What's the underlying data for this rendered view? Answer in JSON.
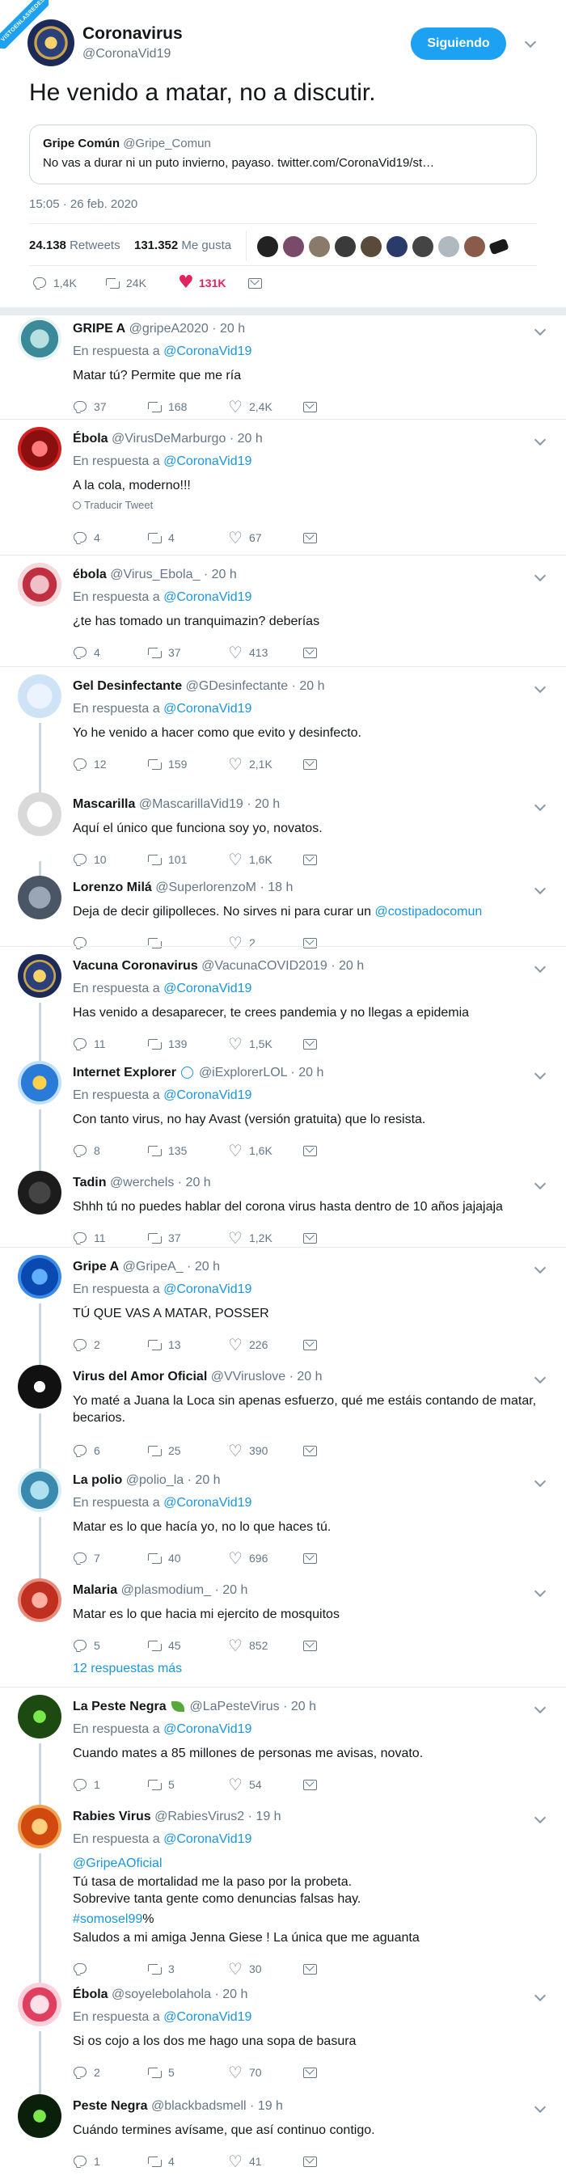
{
  "watermark": "VISTOENLASREDES",
  "tweet": {
    "name": "Coronavirus",
    "handle": "@CoronaVid19",
    "follow_label": "Siguiendo",
    "text": "He venido a matar, no a discutir.",
    "quote": {
      "name": "Gripe Común",
      "handle": "@Gripe_Comun",
      "text": "No vas a durar ni un puto invierno, payaso. twitter.com/CoronaVid19/st…"
    },
    "timestamp": "15:05 · 26 feb. 2020",
    "retweets_num": "24.138",
    "retweets_label": "Retweets",
    "likes_num": "131.352",
    "likes_label": "Me gusta",
    "actions": {
      "replies": "1,4K",
      "retweets": "24K",
      "likes": "131K"
    }
  },
  "colors": {
    "accent": "#1da1f2",
    "link": "#1b95e0",
    "like_red": "#e0245e",
    "muted": "#657786"
  },
  "replies": [
    {
      "name": "GRIPE A",
      "handle": "@gripeA2020",
      "time": "· 20 h",
      "reply_to_label": "En respuesta a",
      "reply_to": "@CoronaVid19",
      "text": "Matar tú? Permite que me ría",
      "counts": [
        "37",
        "168",
        "2,4K"
      ]
    },
    {
      "name": "Ébola",
      "handle": "@VirusDeMarburgo",
      "time": "· 20 h",
      "reply_to_label": "En respuesta a",
      "reply_to": "@CoronaVid19",
      "text": "A la cola, moderno!!!",
      "translate": "Traducir Tweet",
      "counts": [
        "4",
        "4",
        "67"
      ]
    },
    {
      "name": "ébola",
      "handle": "@Virus_Ebola_",
      "time": "· 20 h",
      "reply_to_label": "En respuesta a",
      "reply_to": "@CoronaVid19",
      "text": "¿te has tomado un tranquimazin? deberías",
      "counts": [
        "4",
        "37",
        "413"
      ]
    },
    {
      "name": "Gel Desinfectante",
      "handle": "@GDesinfectante",
      "time": "· 20 h",
      "reply_to_label": "En respuesta a",
      "reply_to": "@CoronaVid19",
      "text": "Yo he venido a hacer como que evito y desinfecto.",
      "counts": [
        "12",
        "159",
        "2,1K"
      ]
    },
    {
      "name": "Mascarilla",
      "handle": "@MascarillaVid19",
      "time": "· 20 h",
      "text": "Aquí el único que funciona soy yo, novatos.",
      "counts": [
        "10",
        "101",
        "1,6K"
      ]
    },
    {
      "name": "Lorenzo Milá",
      "handle": "@SuperlorenzoM",
      "time": "· 18 h",
      "text_pre": "Deja de decir gilipolleces. No sirves ni para curar un ",
      "text_link": "@costipadocomun",
      "counts": [
        "",
        "",
        "2"
      ]
    },
    {
      "name": "Vacuna Coronavirus",
      "handle": "@VacunaCOVID2019",
      "time": "· 20 h",
      "reply_to_label": "En respuesta a",
      "reply_to": "@CoronaVid19",
      "text": "Has venido a desaparecer, te crees pandemia y no llegas a epidemia",
      "counts": [
        "11",
        "139",
        "1,5K"
      ]
    },
    {
      "name": "Internet Explorer",
      "handle": "@iExplorerLOL",
      "time": "· 20 h",
      "reply_to_label": "En respuesta a",
      "reply_to": "@CoronaVid19",
      "text": "Con tanto virus, no hay Avast (versión gratuita) que lo resista.",
      "counts": [
        "8",
        "135",
        "1,6K"
      ]
    },
    {
      "name": "Tadin",
      "handle": "@werchels",
      "time": "· 20 h",
      "text": "Shhh tú no puedes hablar del corona virus hasta dentro de 10 años jajajaja",
      "counts": [
        "11",
        "37",
        "1,2K"
      ]
    },
    {
      "name": "Gripe A",
      "handle": "@GripeA_",
      "time": "· 20 h",
      "reply_to_label": "En respuesta a",
      "reply_to": "@CoronaVid19",
      "text": "TÚ QUE VAS A MATAR, POSSER",
      "counts": [
        "2",
        "13",
        "226"
      ]
    },
    {
      "name": "Virus del Amor Oficial",
      "handle": "@VViruslove",
      "time": "· 20 h",
      "text": "Yo maté a Juana la Loca sin apenas esfuerzo, qué me estáis contando de matar,\nbecarios.",
      "counts": [
        "6",
        "25",
        "390"
      ]
    },
    {
      "name": "La polio",
      "handle": "@polio_la",
      "time": "· 20 h",
      "reply_to_label": "En respuesta a",
      "reply_to": "@CoronaVid19",
      "text": "Matar es lo que hacía yo, no lo que haces tú.",
      "counts": [
        "7",
        "40",
        "696"
      ]
    },
    {
      "name": "Malaria",
      "handle": "@plasmodium_",
      "time": "· 20 h",
      "text": "Matar es lo que hacia mi ejercito de mosquitos",
      "counts": [
        "5",
        "45",
        "852"
      ],
      "more": "12 respuestas más"
    },
    {
      "name": "La Peste Negra",
      "handle": "@LaPesteVirus",
      "time": "· 20 h",
      "reply_to_label": "En respuesta a",
      "reply_to": "@CoronaVid19",
      "text": "Cuando mates a 85 millones de personas me avisas, novato.",
      "counts": [
        "1",
        "5",
        "54"
      ]
    },
    {
      "name": "Rabies Virus",
      "handle": "@RabiesVirus2",
      "time": "· 19 h",
      "reply_to_label": "En respuesta a",
      "reply_to": "@CoronaVid19",
      "mention": "@GripeAOficial",
      "text": "Tú tasa de mortalidad me la paso por la probeta.\nSobrevive tanta gente como denuncias falsas hay.",
      "hashtag": "#somosel99",
      "hashtag_suffix": "%",
      "text2": "Saludos a mi amiga Jenna Giese ! La única que me aguanta",
      "counts": [
        "",
        "3",
        "30"
      ]
    },
    {
      "name": "Ébola",
      "handle": "@soyelebolahola",
      "time": "· 20 h",
      "reply_to_label": "En respuesta a",
      "reply_to": "@CoronaVid19",
      "text": "Si os cojo a los dos me hago una sopa de basura",
      "counts": [
        "2",
        "5",
        "70"
      ]
    },
    {
      "name": "Peste Negra",
      "handle": "@blackbadsmell",
      "time": "· 19 h",
      "text": "Cuándo termines avísame, que así continuo contigo.",
      "counts": [
        "1",
        "4",
        "41"
      ]
    }
  ]
}
